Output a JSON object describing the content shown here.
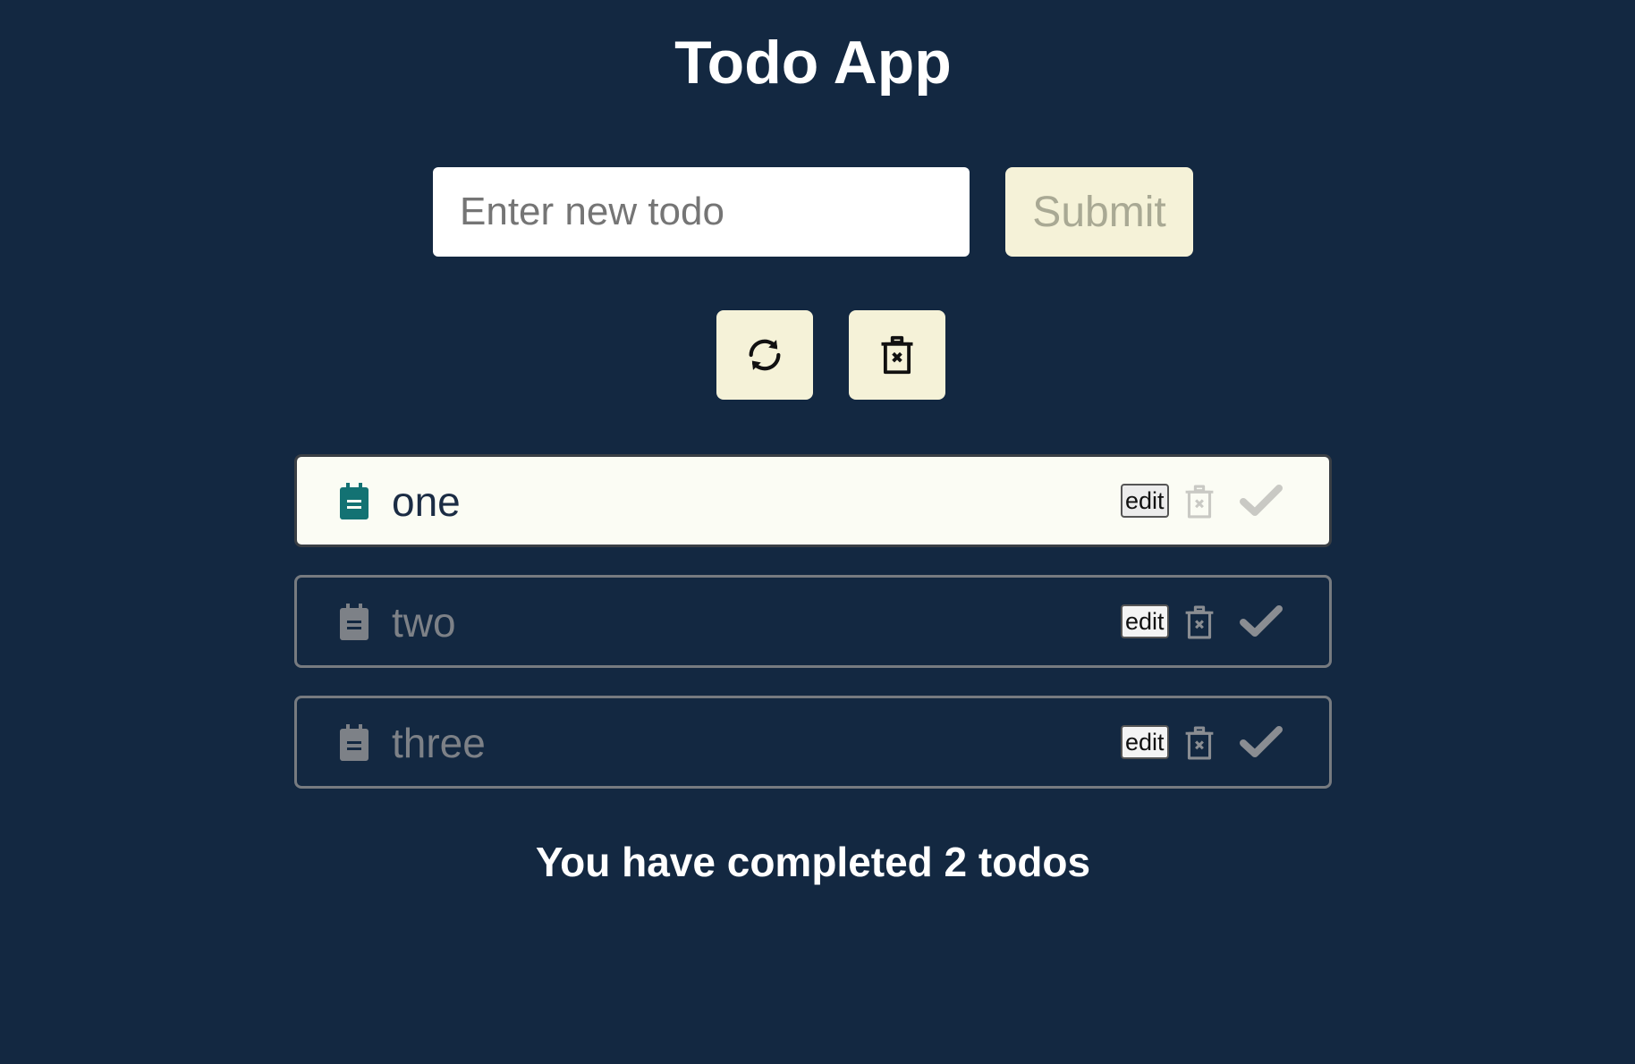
{
  "app": {
    "title": "Todo App"
  },
  "form": {
    "input_value": "",
    "input_placeholder": "Enter new todo",
    "submit_label": "Submit"
  },
  "actions": {
    "refresh_icon": "refresh-icon",
    "clear_all_icon": "trash-x-icon"
  },
  "todos": [
    {
      "text": "one",
      "edit_label": "edit",
      "state": "active",
      "icon": "note-icon"
    },
    {
      "text": "two",
      "edit_label": "edit",
      "state": "completed",
      "icon": "note-icon"
    },
    {
      "text": "three",
      "edit_label": "edit",
      "state": "completed",
      "icon": "note-icon"
    }
  ],
  "status": {
    "text": "You have completed 2 todos"
  },
  "colors": {
    "background": "#132841",
    "button_bg": "#f5f2d8",
    "active_icon": "#137273",
    "muted": "#7d8187"
  }
}
